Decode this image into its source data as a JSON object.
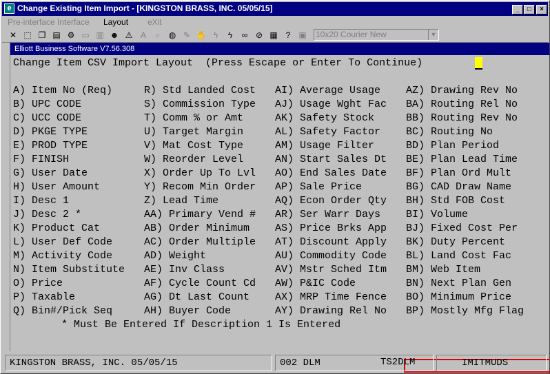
{
  "window": {
    "title": "Change Existing Item Import - [KINGSTON BRASS, INC. 05/05/15]",
    "controls": {
      "minimize": "_",
      "maximize": "□",
      "close": "×"
    }
  },
  "menu": [
    "Pre-interface",
    "Interface",
    "Layout",
    "eXit"
  ],
  "toolbar": {
    "icons": [
      "close-x-icon",
      "select-icon",
      "copy-icon",
      "paste-icon",
      "settings-icon",
      "blank-icon",
      "report-icon",
      "user-icon",
      "warning-icon",
      "font-icon",
      "zoom-icon",
      "globe-icon",
      "edit-icon",
      "hand-icon",
      "lightning-icon",
      "link-icon",
      "stop-icon",
      "cut-icon",
      "notes-icon",
      "help-pointer-icon"
    ],
    "font_select": "10x20 Courier New"
  },
  "inner_title": "Elliott Business Software V7.56.308",
  "screen": {
    "header": "Change Item CSV Import Layout  (Press Escape or Enter To Continue)",
    "columns": [
      [
        "A) Item No (Req)",
        "B) UPC CODE",
        "C) UCC CODE",
        "D) PKGE TYPE",
        "E) PROD TYPE",
        "F) FINISH",
        "G) User Date",
        "H) User Amount",
        "I) Desc 1",
        "J) Desc 2 *",
        "K) Product Cat",
        "L) User Def Code",
        "M) Activity Code",
        "N) Item Substitute",
        "O) Price",
        "P) Taxable",
        "Q) Bin#/Pick Seq"
      ],
      [
        "R) Std Landed Cost",
        "S) Commission Type",
        "T) Comm % or Amt",
        "U) Target Margin",
        "V) Mat Cost Type",
        "W) Reorder Level",
        "X) Order Up To Lvl",
        "Y) Recom Min Order",
        "Z) Lead Time",
        "AA) Primary Vend #",
        "AB) Order Minimum",
        "AC) Order Multiple",
        "AD) Weight",
        "AE) Inv Class",
        "AF) Cycle Count Cd",
        "AG) Dt Last Count",
        "AH) Buyer Code"
      ],
      [
        "AI) Average Usage",
        "AJ) Usage Wght Fac",
        "AK) Safety Stock",
        "AL) Safety Factor",
        "AM) Usage Filter",
        "AN) Start Sales Dt",
        "AO) End Sales Date",
        "AP) Sale Price",
        "AQ) Econ Order Qty",
        "AR) Ser Warr Days",
        "AS) Price Brks App",
        "AT) Discount Apply",
        "AU) Commodity Code",
        "AV) Mstr Sched Itm",
        "AW) P&IC Code",
        "AX) MRP Time Fence",
        "AY) Drawing Rel No"
      ],
      [
        "AZ) Drawing Rev No",
        "BA) Routing Rel No",
        "BB) Routing Rev No",
        "BC) Routing No",
        "BD) Plan Period",
        "BE) Plan Lead Time",
        "BF) Plan Ord Mult",
        "BG) CAD Draw Name",
        "BH) Std FOB Cost",
        "BI) Volume",
        "BJ) Fixed Cost Per",
        "BK) Duty Percent",
        "BL) Land Cost Fac",
        "BM) Web Item",
        "BN) Next Plan Gen",
        "BO) Minimum Price",
        "BP) Mostly Mfg Flag"
      ]
    ],
    "footnote": "* Must Be Entered If Description 1 Is Entered"
  },
  "status": {
    "company": "KINGSTON BRASS, INC. 05/05/15",
    "user": "002 DLM",
    "terminal": "TS2DLM",
    "program": "IMITMUDS"
  },
  "colors": {
    "title_bg": "#000080",
    "highlight": "#e00000",
    "cursor": "#ffff00"
  }
}
